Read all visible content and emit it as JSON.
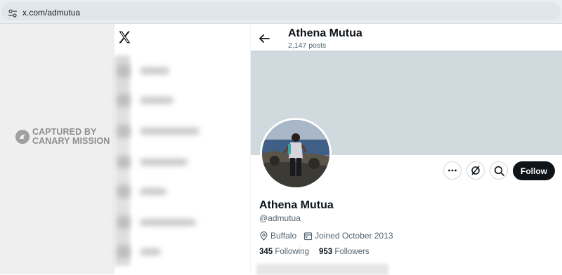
{
  "browser": {
    "url": "x.com/admutua"
  },
  "watermark": {
    "line1": "CAPTURED BY",
    "line2": "CANARY MISSION"
  },
  "header": {
    "name": "Athena Mutua",
    "posts": "2,147 posts"
  },
  "profile": {
    "name": "Athena Mutua",
    "handle": "@admutua",
    "location": "Buffalo",
    "joined": "Joined October 2013",
    "following_count": "345",
    "following_label": "Following",
    "followers_count": "953",
    "followers_label": "Followers"
  },
  "actions": {
    "follow_label": "Follow",
    "more_icon": "more-icon",
    "subscribe_icon": "subscribe-icon",
    "search_icon": "search-icon"
  },
  "colors": {
    "banner": "#cfd9de",
    "follow_bg": "#0f1419",
    "secondary_text": "#536471"
  }
}
